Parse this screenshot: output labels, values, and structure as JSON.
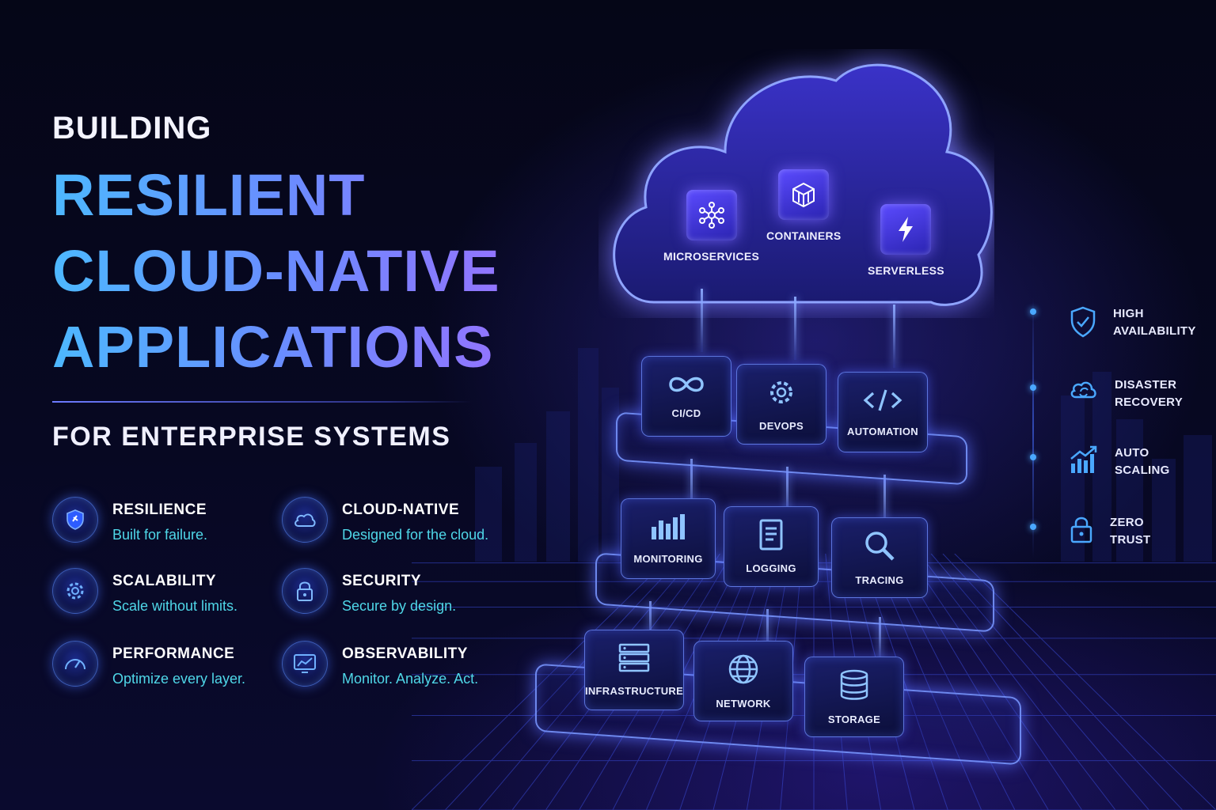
{
  "heading": {
    "line1": "BUILDING",
    "line2": "RESILIENT",
    "line3": "CLOUD-NATIVE",
    "line4": "APPLICATIONS",
    "subtitle": "FOR ENTERPRISE SYSTEMS"
  },
  "features": [
    {
      "name": "RESILIENCE",
      "desc": "Built for failure.",
      "icon": "shield-icon"
    },
    {
      "name": "CLOUD-NATIVE",
      "desc": "Designed for the cloud.",
      "icon": "cloud-icon"
    },
    {
      "name": "SCALABILITY",
      "desc": "Scale without limits.",
      "icon": "gear-icon"
    },
    {
      "name": "SECURITY",
      "desc": "Secure by design.",
      "icon": "lock-icon"
    },
    {
      "name": "PERFORMANCE",
      "desc": "Optimize every layer.",
      "icon": "gauge-icon"
    },
    {
      "name": "OBSERVABILITY",
      "desc": "Monitor. Analyze. Act.",
      "icon": "monitor-chart-icon"
    }
  ],
  "cloud": {
    "nodes": [
      {
        "label": "MICROSERVICES",
        "icon": "network-nodes-icon"
      },
      {
        "label": "CONTAINERS",
        "icon": "container-box-icon"
      },
      {
        "label": "SERVERLESS",
        "icon": "lightning-icon"
      }
    ]
  },
  "layers": [
    {
      "tiles": [
        {
          "label": "CI/CD",
          "icon": "infinity-icon"
        },
        {
          "label": "DEVOPS",
          "icon": "gear-icon"
        },
        {
          "label": "AUTOMATION",
          "icon": "code-icon"
        }
      ]
    },
    {
      "tiles": [
        {
          "label": "MONITORING",
          "icon": "bar-chart-icon"
        },
        {
          "label": "LOGGING",
          "icon": "document-icon"
        },
        {
          "label": "TRACING",
          "icon": "magnifier-icon"
        }
      ]
    },
    {
      "tiles": [
        {
          "label": "INFRASTRUCTURE",
          "icon": "server-icon"
        },
        {
          "label": "NETWORK",
          "icon": "globe-icon"
        },
        {
          "label": "STORAGE",
          "icon": "database-icon"
        }
      ]
    }
  ],
  "benefits": [
    {
      "line1": "HIGH",
      "line2": "AVAILABILITY",
      "icon": "shield-check-icon"
    },
    {
      "line1": "DISASTER",
      "line2": "RECOVERY",
      "icon": "cloud-sync-icon"
    },
    {
      "line1": "AUTO",
      "line2": "SCALING",
      "icon": "growth-chart-icon"
    },
    {
      "line1": "ZERO",
      "line2": "TRUST",
      "icon": "padlock-icon"
    }
  ],
  "colors": {
    "background": "#05061a",
    "accent_blue": "#4db8ff",
    "accent_purple": "#a06cff",
    "feature_desc": "#4fd7e8"
  }
}
